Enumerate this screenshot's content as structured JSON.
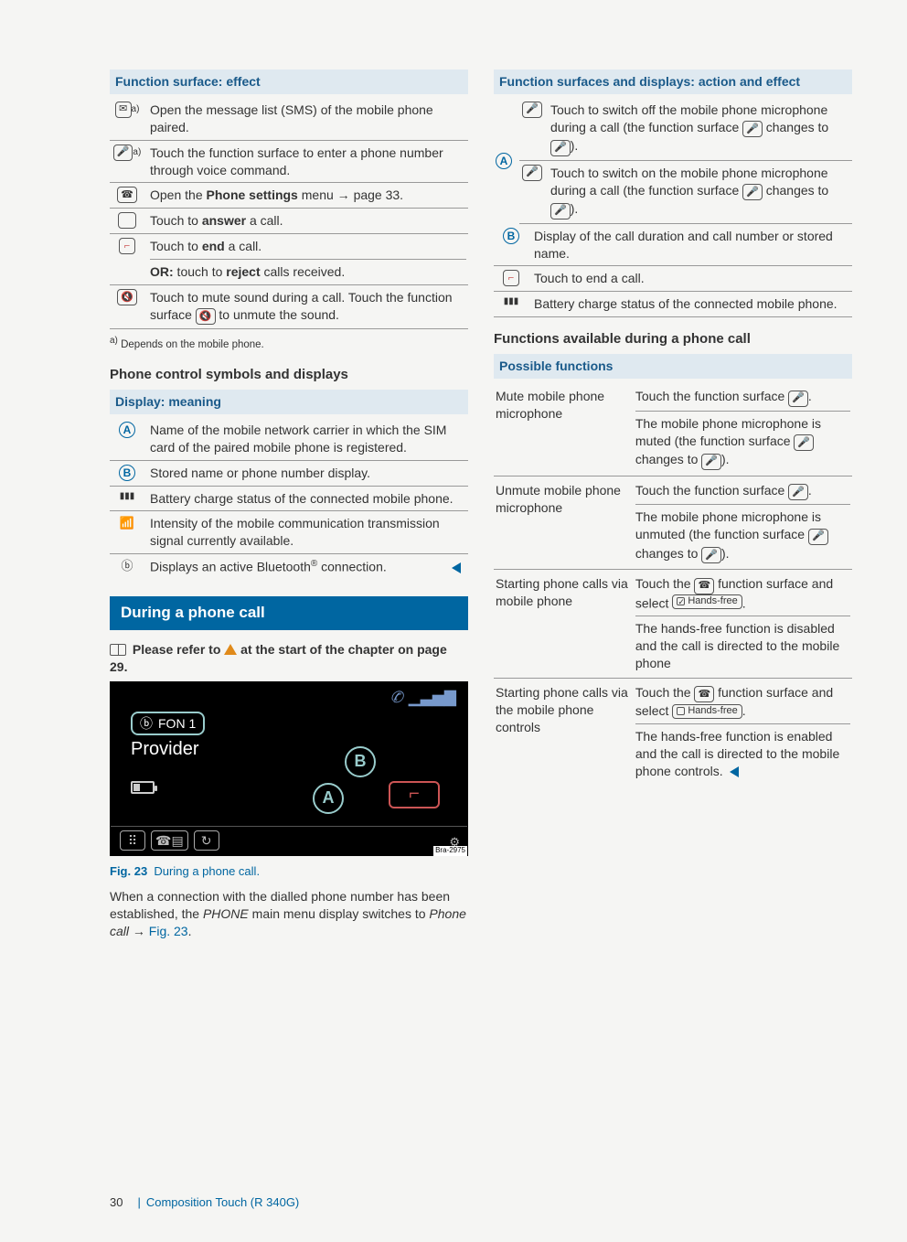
{
  "col1": {
    "funcSurfaceHeader": "Function surface: effect",
    "funcSurfaceRows": [
      {
        "icon": "✉",
        "sup": "a)",
        "text": "Open the message list (SMS) of the mobile phone paired."
      },
      {
        "icon": "🎤",
        "sup": "a)",
        "text": "Touch the function surface to enter a phone number through voice command."
      },
      {
        "icon": "☎",
        "text_bold_lead": "Open the ",
        "text_bold": "Phone settings",
        "text_tail": " menu ",
        "arrow": true,
        "text_tail2": "page 33."
      },
      {
        "icon": "□",
        "text_pre": "Touch to ",
        "text_bold": "answer",
        "text_post": " a call."
      },
      {
        "icon_phone_end": true,
        "lines": [
          {
            "pre": "Touch to ",
            "bold": "end",
            "post": " a call."
          },
          {
            "bold_lead": "OR:",
            "pre": " touch to ",
            "bold": "reject",
            "post": " calls received."
          }
        ]
      },
      {
        "icon": "🔇",
        "text": "Touch to mute sound during a call. Touch the function surface ",
        "inline_icon": "🔇",
        "text2": " to unmute the sound."
      }
    ],
    "footnote": {
      "mark": "a)",
      "text": "Depends on the mobile phone."
    },
    "phoneSymbolsHeading": "Phone control symbols and displays",
    "displayHeader": "Display: meaning",
    "displayRows": [
      {
        "letter": "A",
        "text": "Name of the mobile network carrier in which the SIM card of the paired mobile phone is registered."
      },
      {
        "letter": "B",
        "text": "Stored name or phone number display."
      },
      {
        "icon": "▮▮▮",
        "text": "Battery charge status of the connected mobile phone."
      },
      {
        "icon": "📶",
        "text": "Intensity of the mobile communication transmission signal currently available."
      },
      {
        "icon": "ⓑ",
        "text_pre": "Displays an active Bluetooth",
        "reg": "®",
        "text_post": " connection.",
        "end_mark": true
      }
    ],
    "duringHeading": "During a phone call",
    "noteLine": {
      "pre": "Please refer to ",
      "post": " at the start of the chapter on page 29."
    },
    "screenshot": {
      "fon": "FON 1",
      "provider": "Provider",
      "tag": "Bra-2975"
    },
    "figCaption": {
      "num": "Fig. 23",
      "text": "During a phone call."
    },
    "bodyText": {
      "p1": "When a connection with the dialled phone number has been established, the ",
      "italic": "PHONE",
      "p2": " main menu display switches to ",
      "italic2": "Phone call",
      "arrow": " → ",
      "link": "Fig. 23",
      "tail": "."
    }
  },
  "col2": {
    "effectHeader": "Function surfaces and displays: action and effect",
    "groupA": {
      "letter": "A",
      "rows": [
        {
          "icon": "🎤",
          "text": "Touch to switch off the mobile phone microphone during a call (the function surface ",
          "i1": "🎤",
          "mid": " changes to ",
          "i2": "🎤",
          "tail": ")."
        },
        {
          "icon": "🎤",
          "text": "Touch to switch on the mobile phone microphone during a call (the function surface ",
          "i1": "🎤",
          "mid": " changes to ",
          "i2": "🎤",
          "tail": ")."
        }
      ]
    },
    "rowB": {
      "letter": "B",
      "text": "Display of the call duration and call number or stored name."
    },
    "rowEnd": {
      "icon_phone_end": true,
      "text": "Touch to end a call."
    },
    "rowBatt": {
      "icon": "▮▮▮",
      "text": "Battery charge status of the connected mobile phone."
    },
    "funcAvailHeading": "Functions available during a phone call",
    "possibleHeader": "Possible functions",
    "possibleRows": [
      {
        "label": "Mute mobile phone microphone",
        "r1": {
          "pre": "Touch the function surface ",
          "icon": "🎤",
          "post": "."
        },
        "r2": {
          "pre": "The mobile phone microphone is muted (the function surface ",
          "i1": "🎤",
          "mid": " changes to ",
          "i2": "🎤",
          "post": ")."
        }
      },
      {
        "label": "Unmute mobile phone microphone",
        "r1": {
          "pre": "Touch the function surface ",
          "icon": "🎤",
          "post": "."
        },
        "r2": {
          "pre": "The mobile phone microphone is unmuted (the function surface ",
          "i1": "🎤",
          "mid": " changes to ",
          "i2": "🎤",
          "post": ")."
        }
      },
      {
        "label": "Starting phone calls via mobile phone",
        "r1": {
          "pre": "Touch the ",
          "icon": "☎",
          "mid": " function surface and select ",
          "pill_checked": true,
          "pill": "Hands-free",
          "post": "."
        },
        "r2": {
          "text": "The hands-free function is disabled and the call is directed to the mobile phone"
        }
      },
      {
        "label": "Starting phone calls via the mobile phone controls",
        "r1": {
          "pre": "Touch the ",
          "icon": "☎",
          "mid": " function surface and select ",
          "pill_checked": false,
          "pill": "Hands-free",
          "post": "."
        },
        "r2": {
          "text": "The hands-free function is enabled and the call is directed to the mobile phone controls.",
          "end_mark": true
        }
      }
    ]
  },
  "footer": {
    "page": "30",
    "title": "Composition Touch (R 340G)"
  }
}
